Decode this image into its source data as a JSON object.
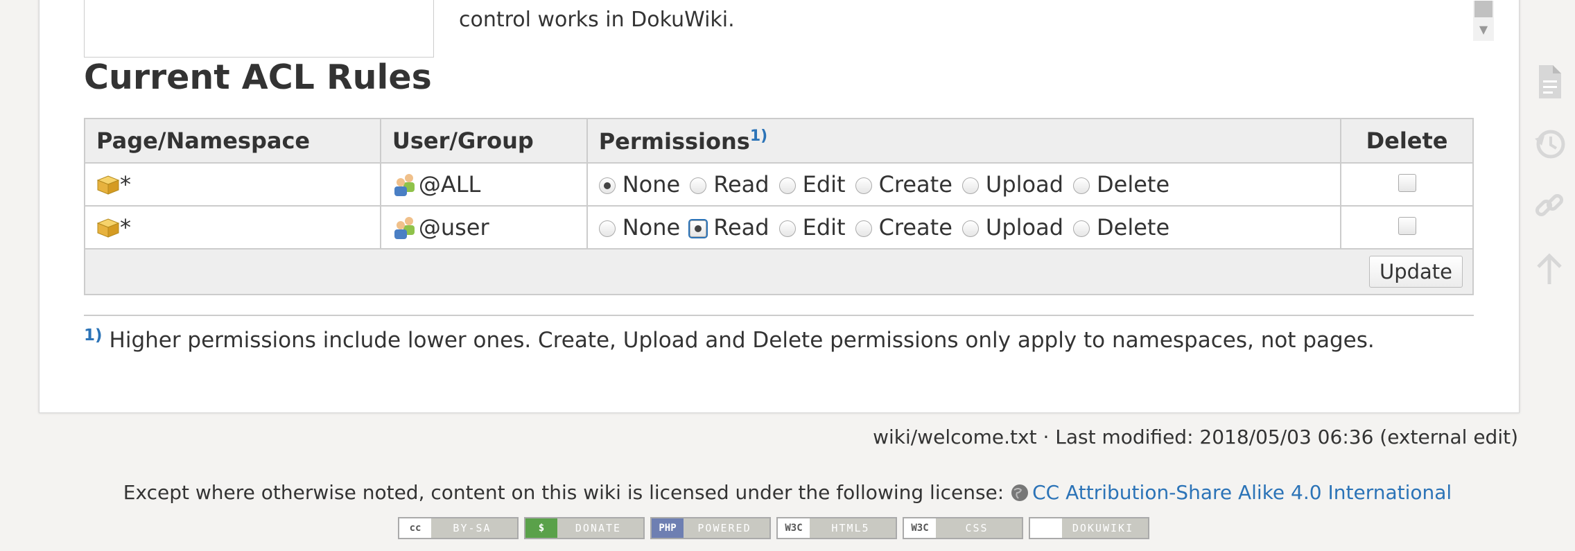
{
  "intro": {
    "text": "control works in DokuWiki."
  },
  "section_title": "Current ACL Rules",
  "table": {
    "headers": {
      "page": "Page/Namespace",
      "user": "User/Group",
      "permissions": "Permissions",
      "footnote_ref": "1)",
      "delete": "Delete"
    },
    "permission_labels": [
      "None",
      "Read",
      "Edit",
      "Create",
      "Upload",
      "Delete"
    ],
    "rows": [
      {
        "namespace": "*",
        "group": "@ALL",
        "selected": "None"
      },
      {
        "namespace": "*",
        "group": "@user",
        "selected": "Read"
      }
    ],
    "update_label": "Update"
  },
  "footnote": {
    "mark": "1)",
    "text": "Higher permissions include lower ones. Create, Upload and Delete permissions only apply to namespaces, not pages."
  },
  "docinfo": "wiki/welcome.txt · Last modified: 2018/05/03 06:36 (external edit)",
  "license": {
    "prefix": "Except where otherwise noted, content on this wiki is licensed under the following license:",
    "link_text": "CC Attribution-Share Alike 4.0 International"
  },
  "badges": [
    {
      "tag": "cc",
      "label": "BY-SA"
    },
    {
      "tag": "$",
      "label": "DONATE"
    },
    {
      "tag": "PHP",
      "label": "POWERED"
    },
    {
      "tag": "W3C",
      "label": "HTML5"
    },
    {
      "tag": "W3C",
      "label": "CSS"
    },
    {
      "tag": "",
      "label": "DOKUWIKI"
    }
  ],
  "colors": {
    "link": "#2b73b7",
    "header_bg": "#eeeeee",
    "border": "#cccccc"
  },
  "pagetools_icons": [
    "page-icon",
    "history-icon",
    "link-icon",
    "back-to-top-icon"
  ]
}
